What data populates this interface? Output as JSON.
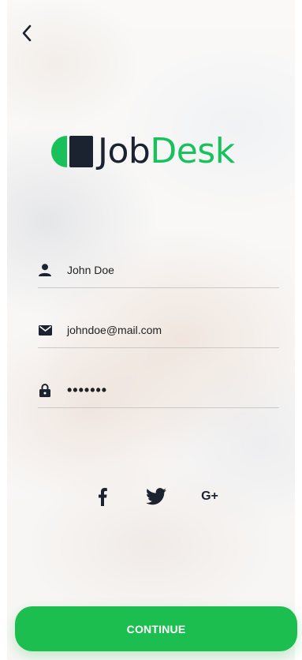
{
  "brand": {
    "name_part1": "Job",
    "name_part2": "Desk",
    "accent_color": "#19c15c",
    "dark_color": "#1b2230"
  },
  "nav": {
    "back_icon": "chevron-left-icon"
  },
  "form": {
    "name": {
      "value": "John Doe",
      "icon": "user-icon"
    },
    "email": {
      "value": "johndoe@mail.com",
      "icon": "envelope-icon"
    },
    "password": {
      "value": "•••••••",
      "icon": "lock-icon"
    }
  },
  "social": {
    "facebook_icon": "facebook-icon",
    "twitter_icon": "twitter-icon",
    "google_label": "G+"
  },
  "actions": {
    "continue_label": "CONTINUE",
    "continue_color": "#1cbf4f"
  }
}
